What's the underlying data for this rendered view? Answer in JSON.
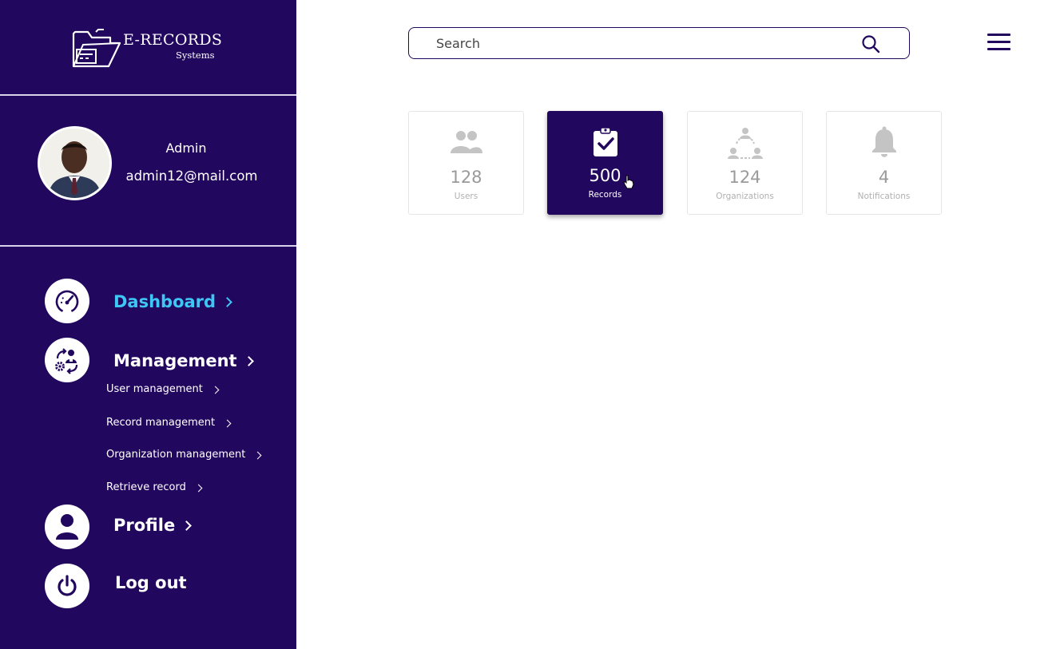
{
  "brand": {
    "title": "E-RECORDS",
    "subtitle": "Systems"
  },
  "profile": {
    "name": "Admin",
    "email": "admin12@mail.com"
  },
  "nav": {
    "dashboard": "Dashboard",
    "management": "Management",
    "sub_items": [
      "User management",
      "Record management",
      "Organization management",
      "Retrieve record"
    ],
    "profile": "Profile",
    "logout": "Log out"
  },
  "search": {
    "placeholder": "Search"
  },
  "cards": [
    {
      "icon": "users-icon",
      "count": "128",
      "label": "Users"
    },
    {
      "icon": "clipboard-check-icon",
      "count": "500",
      "label": "Records"
    },
    {
      "icon": "organization-icon",
      "count": "124",
      "label": "Organizations"
    },
    {
      "icon": "bell-icon",
      "count": "4",
      "label": "Notifications"
    }
  ],
  "colors": {
    "sidebar": "#22075e",
    "active_nav": "#3ec6f4",
    "card_muted": "#c4c4c4"
  }
}
